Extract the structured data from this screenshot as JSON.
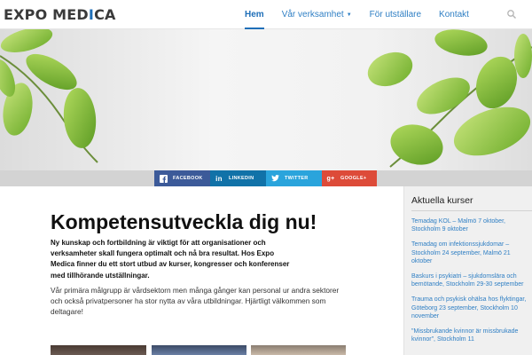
{
  "brand": {
    "part1": "EXPO MED",
    "part2": "I",
    "part3": "CA"
  },
  "nav": {
    "items": [
      {
        "label": "Hem"
      },
      {
        "label": "Vår verksamhet"
      },
      {
        "label": "För utställare"
      },
      {
        "label": "Kontakt"
      }
    ],
    "search_icon": "search-icon"
  },
  "social": {
    "facebook": "FACEBOOK",
    "linkedin": "LINKEDIN",
    "twitter": "TWITTER",
    "google": "GOOGLE+",
    "colors": {
      "facebook": "#3c5a99",
      "linkedin": "#1172a8",
      "twitter": "#2aa4dc",
      "google": "#dd4b39"
    }
  },
  "main": {
    "title": "Kompetensutveckla dig nu!",
    "lead": "Ny kunskap och fortbildning är viktigt för att organisationer och verksamheter skall fungera optimalt och nå bra resultat. Hos Expo Medica finner du ett stort utbud av kurser, kongresser och konferenser med tillhörande utställningar.",
    "body": "Vår primära målgrupp är vårdsektorn men många gånger kan personal ur andra sektorer och också privatpersoner ha stor nytta av våra utbildningar. Hjärtligt välkommen som deltagare!"
  },
  "sidebar": {
    "title": "Aktuella kurser",
    "courses": [
      "Temadag KOL – Malmö 7 oktober, Stockholm 9 oktober",
      "Temadag om infektionssjukdomar – Stockholm 24 september, Malmö 21 oktober",
      "Baskurs i psykiatri – sjukdomslära och bemötande, Stockholm 29-30 september",
      "Trauma och psykisk ohälsa hos flyktingar, Göteborg 23 september, Stockholm 10 november",
      "\"Missbrukande kvinnor är missbrukade kvinnor\", Stockholm 11"
    ]
  },
  "accent_color": "#1f6fb8"
}
